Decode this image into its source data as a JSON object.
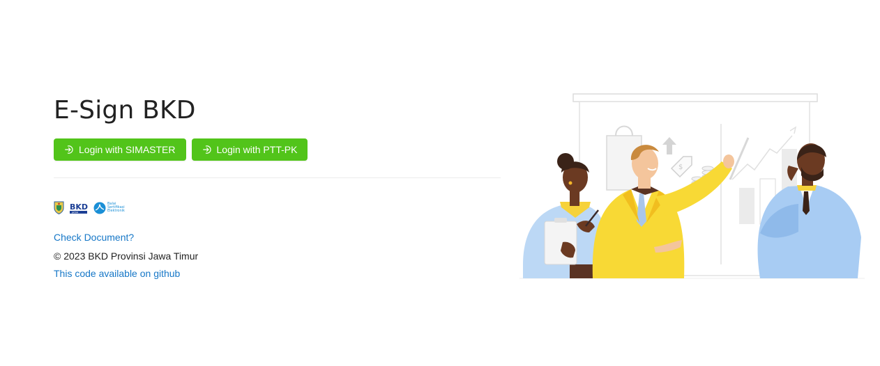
{
  "page": {
    "title": "E-Sign BKD"
  },
  "actions": {
    "login_simaster": "Login with SIMASTER",
    "login_pttpk": "Login with PTT-PK"
  },
  "logos": {
    "bkd_text": "BKD",
    "bkd_sub": "JATIM",
    "bsre_line1": "Balai",
    "bsre_line2": "Sertifikasi",
    "bsre_line3": "Elektronik"
  },
  "links": {
    "check_document": "Check Document?",
    "github": "This code available on github"
  },
  "footer": {
    "copyright": "© 2023 BKD Provinsi Jawa Timur"
  },
  "icons": {
    "login": "login-icon",
    "illustration": "business-team-illustration"
  },
  "colors": {
    "primary": "#52c41a",
    "link": "#1677c7"
  }
}
